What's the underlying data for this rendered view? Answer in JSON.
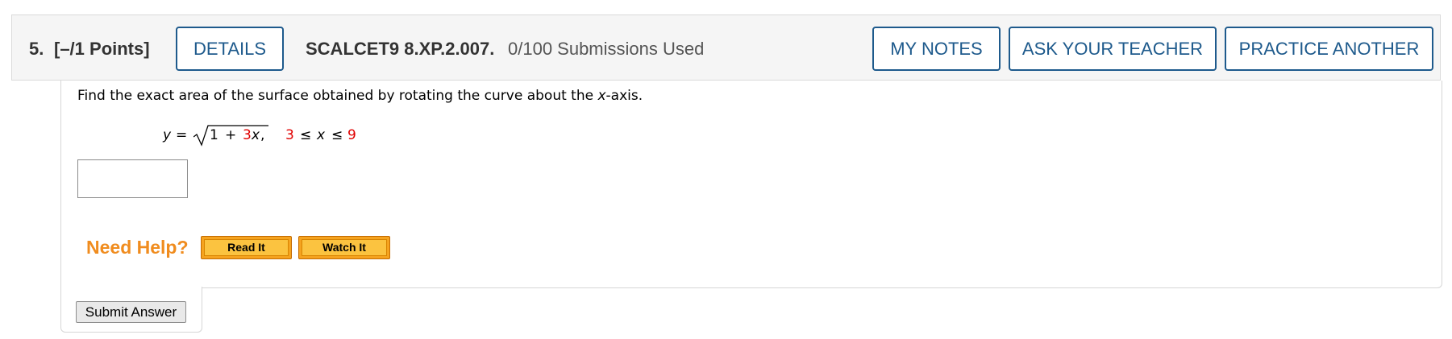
{
  "header": {
    "question_number": "5.",
    "points": "[–/1 Points]",
    "details_label": "DETAILS",
    "problem_code": "SCALCET9 8.XP.2.007.",
    "submissions": "0/100 Submissions Used",
    "my_notes_label": "MY NOTES",
    "ask_teacher_label": "ASK YOUR TEACHER",
    "practice_another_label": "PRACTICE ANOTHER"
  },
  "question": {
    "prompt_before": "Find the exact area of the surface obtained by rotating the curve about the ",
    "prompt_var": "x",
    "prompt_after": "-axis.",
    "equation": {
      "y": "y",
      "equals": "=",
      "one": "1",
      "plus": "+",
      "coefficient": "3",
      "x": "x",
      "comma": ",",
      "lower": "3",
      "le1": "≤",
      "x_var": "x",
      "le2": "≤",
      "upper": "9"
    },
    "answer_value": ""
  },
  "help": {
    "label": "Need Help?",
    "read_it": "Read It",
    "watch_it": "Watch It"
  },
  "submit_label": "Submit Answer",
  "colors": {
    "accent_blue": "#1e5a8c",
    "help_orange": "#f08c1e",
    "variable_red": "#e00000",
    "header_bg": "#f5f5f5"
  }
}
